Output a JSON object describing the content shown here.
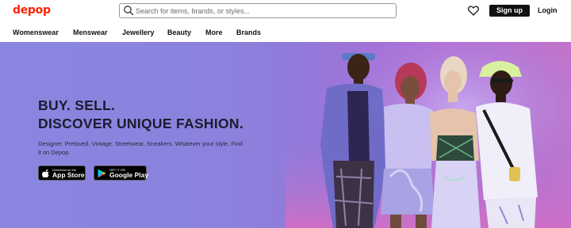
{
  "header": {
    "logo": "depop",
    "search_placeholder": "Search for items, brands, or styles...",
    "signup_label": "Sign up",
    "login_label": "Login"
  },
  "nav": {
    "items": [
      "Womenswear",
      "Menswear",
      "Jewellery",
      "Beauty",
      "More",
      "Brands"
    ]
  },
  "hero": {
    "headline_line1": "BUY. SELL.",
    "headline_line2": "DISCOVER UNIQUE FASHION.",
    "subtext": "Designer. Preloved. Vintage. Streetwear. Sneakers. Whatever your style. Find it on Depop.",
    "app_store": {
      "small": "Download on the",
      "big": "App Store"
    },
    "google_play": {
      "small": "GET IT ON",
      "big": "Google Play"
    }
  },
  "colors": {
    "brand": "#ff2300",
    "button_dark": "#111111",
    "hero_left": "#8a86e0",
    "hero_right": "#c773c8"
  },
  "icons": [
    "search-icon",
    "heart-icon",
    "apple-icon",
    "google-play-icon"
  ]
}
